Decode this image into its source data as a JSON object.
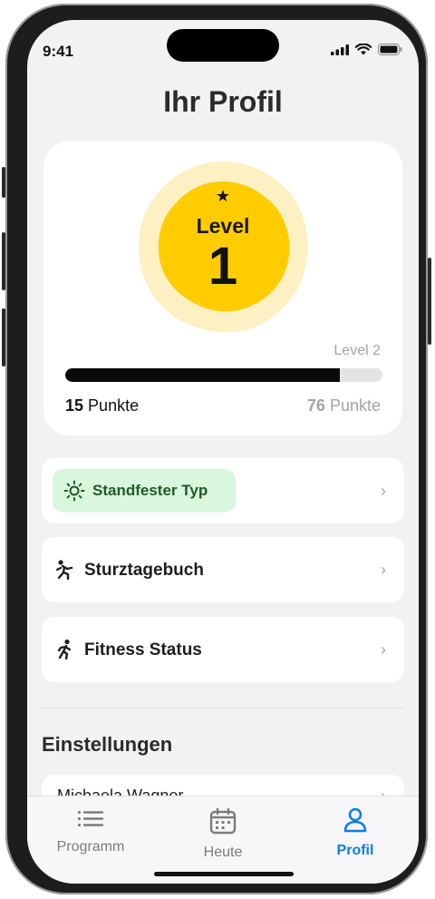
{
  "status_bar": {
    "time": "9:41"
  },
  "page": {
    "title": "Ihr Profil"
  },
  "level_card": {
    "badge_label": "Level",
    "level_number": "1",
    "next_level_label": "Level 2",
    "progress_fraction": 0.865,
    "current_points": "15",
    "target_points": "76",
    "points_unit": "Punkte",
    "badge_color": "#ffcc00",
    "badge_halo_color": "#fdf0c2"
  },
  "rows": [
    {
      "label": "Standfester Typ",
      "icon": "sun-icon",
      "highlighted": true
    },
    {
      "label": "Sturztagebuch",
      "icon": "fall-person-icon"
    },
    {
      "label": "Fitness Status",
      "icon": "running-person-icon"
    }
  ],
  "settings": {
    "heading": "Einstellungen",
    "first_item": "Michaela Wagner"
  },
  "tabs": [
    {
      "label": "Programm",
      "icon": "list-icon"
    },
    {
      "label": "Heute",
      "icon": "calendar-icon"
    },
    {
      "label": "Profil",
      "icon": "person-icon",
      "active": true
    }
  ],
  "colors": {
    "accent": "#0d7fe6",
    "chip_bg": "#d9f7dd",
    "chip_text": "#1f5a2a"
  }
}
